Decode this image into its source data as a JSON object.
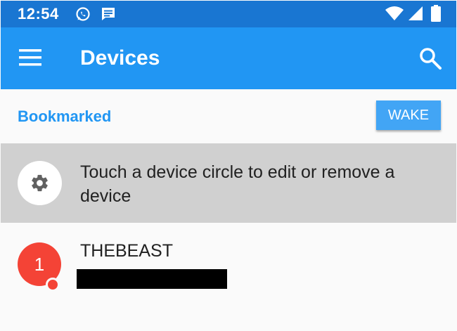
{
  "status_bar": {
    "time": "12:54",
    "icons": [
      "whatsapp-icon",
      "message-icon",
      "wifi-icon",
      "signal-icon",
      "battery-icon"
    ],
    "color": "#1976d2"
  },
  "app_bar": {
    "title": "Devices",
    "menu_icon": "menu-icon",
    "search_icon": "search-icon",
    "color": "#2196f3"
  },
  "bookmarked": {
    "header": "Bookmarked",
    "wake_label": "WAKE"
  },
  "hint": {
    "icon": "gear-icon",
    "text": "Touch a device circle to edit or remove a device"
  },
  "devices": [
    {
      "badge": "1",
      "name": "THEBEAST",
      "badge_color": "#f44336"
    }
  ]
}
